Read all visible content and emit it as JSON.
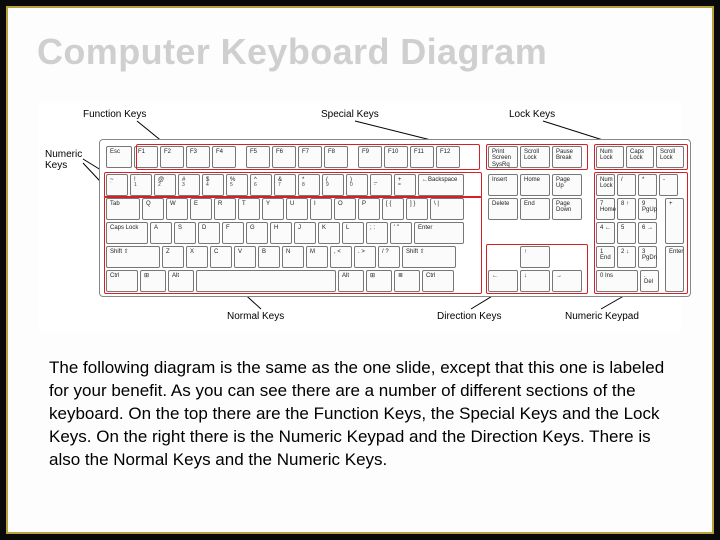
{
  "title": "Computer Keyboard Diagram",
  "labels": {
    "function": "Function Keys",
    "special": "Special Keys",
    "lock": "Lock Keys",
    "numeric": "Numeric\nKeys",
    "normal": "Normal Keys",
    "direction": "Direction Keys",
    "keypad": "Numeric Keypad"
  },
  "rows": {
    "fn": [
      "Esc",
      "F1",
      "F2",
      "F3",
      "F4",
      "F5",
      "F6",
      "F7",
      "F8",
      "F9",
      "F10",
      "F11",
      "F12"
    ],
    "spec": [
      "Print Screen SysRq",
      "Scroll Lock",
      "Pause Break"
    ],
    "lock": [
      "Num Lock",
      "Caps Lock",
      "Scroll Lock"
    ],
    "num1": [
      [
        "~",
        "`"
      ],
      [
        "!",
        "1"
      ],
      [
        "@",
        "2"
      ],
      [
        "#",
        "3"
      ],
      [
        "$",
        "4"
      ],
      [
        "%",
        "5"
      ],
      [
        "^",
        "6"
      ],
      [
        "&",
        "7"
      ],
      [
        "*",
        "8"
      ],
      [
        "(",
        "9"
      ],
      [
        ")",
        "0"
      ],
      [
        "_",
        "-"
      ],
      [
        "+",
        "="
      ],
      [
        "←Backspace",
        ""
      ]
    ],
    "qw": [
      "Tab",
      "Q",
      "W",
      "E",
      "R",
      "T",
      "Y",
      "U",
      "I",
      "O",
      "P",
      "[ {",
      "] }",
      "\\ |"
    ],
    "as": [
      "Caps Lock",
      "A",
      "S",
      "D",
      "F",
      "G",
      "H",
      "J",
      "K",
      "L",
      "; :",
      "' \"",
      "Enter"
    ],
    "zx": [
      "Shift ⇧",
      "Z",
      "X",
      "C",
      "V",
      "B",
      "N",
      "M",
      ", <",
      ". >",
      "/ ?",
      "Shift ⇧"
    ],
    "bot": [
      "Ctrl",
      "⊞",
      "Alt",
      "",
      "Alt",
      "⊞",
      "≣",
      "Ctrl"
    ],
    "nav1": [
      "Insert",
      "Home",
      "Page Up"
    ],
    "nav2": [
      "Delete",
      "End",
      "Page Down"
    ],
    "ar1": [
      "↑"
    ],
    "ar2": [
      "←",
      "↓",
      "→"
    ],
    "kpR1": [
      "Num Lock",
      "/",
      "*",
      "-"
    ],
    "kpR2": [
      "7 Home",
      "8 ↑",
      "9 PgUp"
    ],
    "kpR3": [
      "4 ←",
      "5",
      "6 →"
    ],
    "kpR4": [
      "1 End",
      "2 ↓",
      "3 PgDn"
    ],
    "kpR5": [
      "0 Ins",
      ". Del"
    ],
    "kpPlus": "+",
    "kpEnter": "Enter"
  },
  "paragraph": "The following diagram is the same as the one slide, except that this one is labeled for your benefit. As you can see there are a number of different sections of the keyboard. On the top there are the Function Keys, the Special Keys and the Lock Keys. On the right there is the Numeric Keypad and the Direction Keys. There is also the Normal Keys and the Numeric Keys."
}
